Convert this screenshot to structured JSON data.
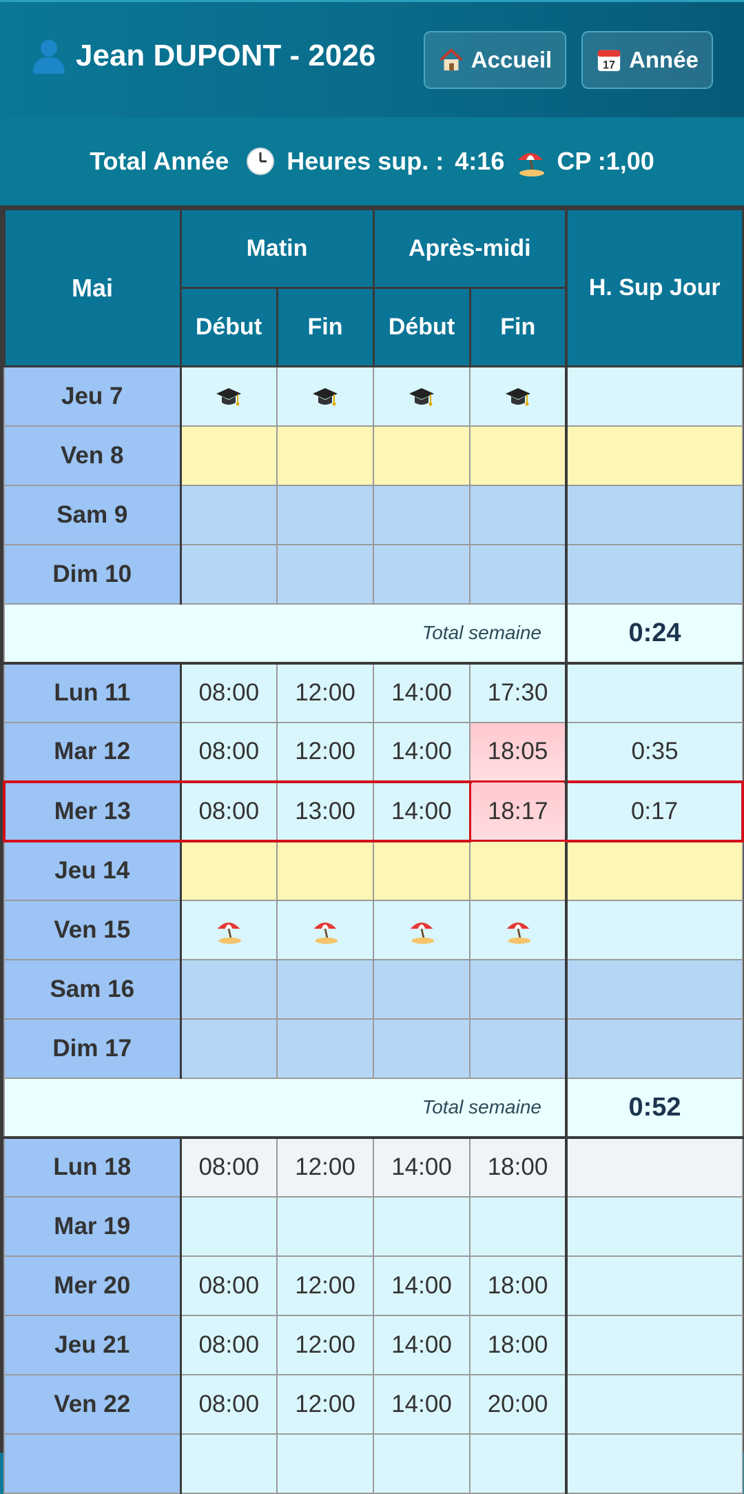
{
  "header": {
    "user_name": "Jean DUPONT - 2026",
    "user_icon": "person-icon",
    "home_label": "Accueil",
    "home_icon": "house-icon",
    "year_label": "Année",
    "year_icon": "calendar-icon",
    "colors": {
      "header_bg": "#0a7796",
      "accent": "#0a7596",
      "highlight": "#d30f1a"
    }
  },
  "summary": {
    "label": "Total Année",
    "overtime_label": "Heures sup. :",
    "overtime_value": "4:16",
    "overtime_icon": "clock-icon",
    "cp_label": "CP :",
    "cp_value": "1,00",
    "cp_icon": "beach-umbrella-icon"
  },
  "table": {
    "month": "Mai",
    "col_morning": "Matin",
    "col_afternoon": "Après-midi",
    "col_start": "Début",
    "col_end": "Fin",
    "col_overtime": "H. Sup Jour",
    "total_week_label": "Total semaine",
    "days": [
      {
        "label": "Jeu 7",
        "kind": "training",
        "icon": "graduation-cap-icon",
        "m_start": "",
        "m_end": "",
        "a_start": "",
        "a_end": "",
        "hsup": ""
      },
      {
        "label": "Ven 8",
        "kind": "holiday",
        "m_start": "",
        "m_end": "",
        "a_start": "",
        "a_end": "",
        "hsup": ""
      },
      {
        "label": "Sam 9",
        "kind": "weekend",
        "m_start": "",
        "m_end": "",
        "a_start": "",
        "a_end": "",
        "hsup": ""
      },
      {
        "label": "Dim 10",
        "kind": "weekend",
        "m_start": "",
        "m_end": "",
        "a_start": "",
        "a_end": "",
        "hsup": ""
      },
      {
        "label": "Lun 11",
        "kind": "work",
        "m_start": "08:00",
        "m_end": "12:00",
        "a_start": "14:00",
        "a_end": "17:30",
        "hsup": ""
      },
      {
        "label": "Mar 12",
        "kind": "work",
        "over": true,
        "m_start": "08:00",
        "m_end": "12:00",
        "a_start": "14:00",
        "a_end": "18:05",
        "hsup": "0:35"
      },
      {
        "label": "Mer 13",
        "kind": "work",
        "over": true,
        "current": true,
        "m_start": "08:00",
        "m_end": "13:00",
        "a_start": "14:00",
        "a_end": "18:17",
        "hsup": "0:17"
      },
      {
        "label": "Jeu 14",
        "kind": "holiday",
        "m_start": "",
        "m_end": "",
        "a_start": "",
        "a_end": "",
        "hsup": ""
      },
      {
        "label": "Ven 15",
        "kind": "leave",
        "icon": "beach-umbrella-icon",
        "m_start": "",
        "m_end": "",
        "a_start": "",
        "a_end": "",
        "hsup": ""
      },
      {
        "label": "Sam 16",
        "kind": "weekend",
        "m_start": "",
        "m_end": "",
        "a_start": "",
        "a_end": "",
        "hsup": ""
      },
      {
        "label": "Dim 17",
        "kind": "weekend",
        "m_start": "",
        "m_end": "",
        "a_start": "",
        "a_end": "",
        "hsup": ""
      },
      {
        "label": "Lun 18",
        "kind": "grey",
        "m_start": "08:00",
        "m_end": "12:00",
        "a_start": "14:00",
        "a_end": "18:00",
        "hsup": ""
      },
      {
        "label": "Mar 19",
        "kind": "work",
        "m_start": "",
        "m_end": "",
        "a_start": "",
        "a_end": "",
        "hsup": ""
      },
      {
        "label": "Mer 20",
        "kind": "work",
        "m_start": "08:00",
        "m_end": "12:00",
        "a_start": "14:00",
        "a_end": "18:00",
        "hsup": ""
      },
      {
        "label": "Jeu 21",
        "kind": "work",
        "m_start": "08:00",
        "m_end": "12:00",
        "a_start": "14:00",
        "a_end": "18:00",
        "hsup": ""
      },
      {
        "label": "Ven 22",
        "kind": "work",
        "m_start": "08:00",
        "m_end": "12:00",
        "a_start": "14:00",
        "a_end": "20:00",
        "hsup": ""
      },
      {
        "label": "",
        "kind": "work",
        "m_start": "",
        "m_end": "",
        "a_start": "",
        "a_end": "",
        "hsup": ""
      }
    ],
    "week_totals": [
      "0:24",
      "0:52"
    ]
  }
}
